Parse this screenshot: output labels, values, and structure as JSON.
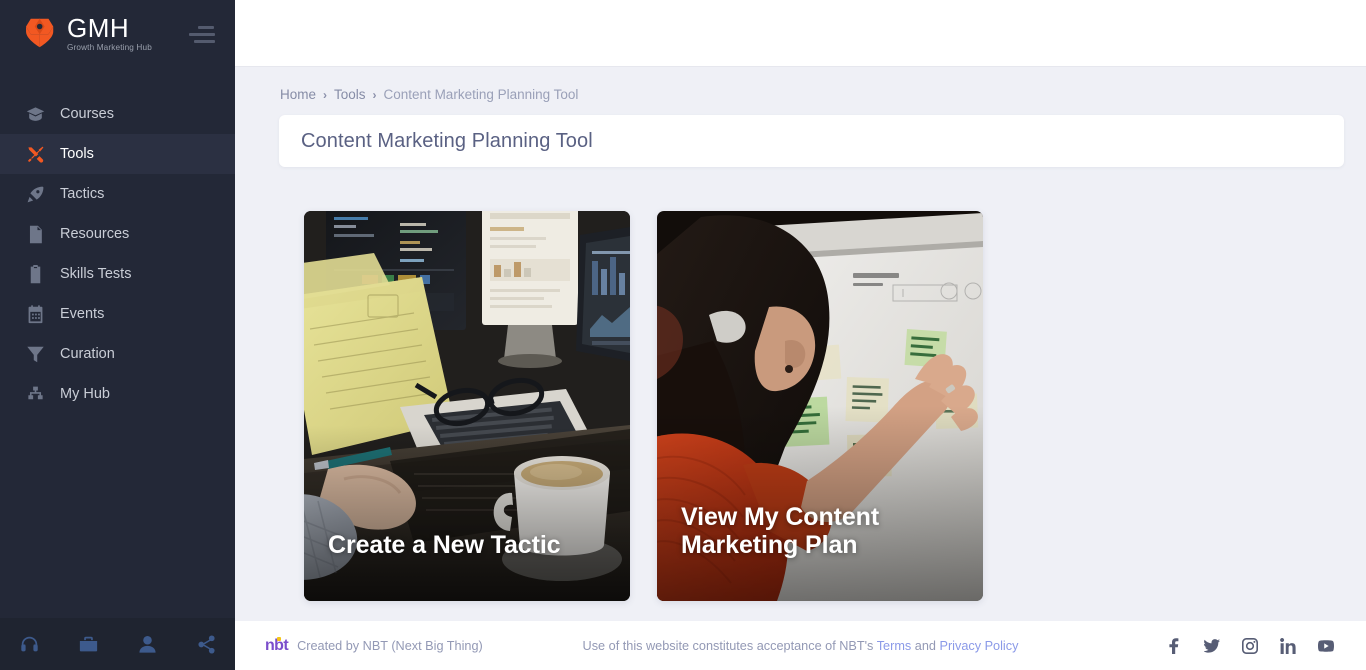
{
  "sidebar": {
    "logo": {
      "title": "GMH",
      "subtitle": "Growth Marketing Hub",
      "mark": "hexagon-logo-icon"
    },
    "menu_icon": "hamburger-menu-icon",
    "items": [
      {
        "label": "Courses",
        "icon": "graduation-cap-icon",
        "active": false
      },
      {
        "label": "Tools",
        "icon": "tools-icon",
        "active": true
      },
      {
        "label": "Tactics",
        "icon": "rocket-icon",
        "active": false
      },
      {
        "label": "Resources",
        "icon": "document-icon",
        "active": false
      },
      {
        "label": "Skills Tests",
        "icon": "clipboard-check-icon",
        "active": false
      },
      {
        "label": "Events",
        "icon": "calendar-icon",
        "active": false
      },
      {
        "label": "Curation",
        "icon": "funnel-icon",
        "active": false
      },
      {
        "label": "My Hub",
        "icon": "sitemap-icon",
        "active": false
      }
    ],
    "bottom_icons": [
      "headphones-icon",
      "briefcase-icon",
      "user-icon",
      "share-icon"
    ],
    "accent_color": "#f25822",
    "background_color": "#232837"
  },
  "breadcrumb": {
    "items": [
      "Home",
      "Tools",
      "Content Marketing Planning Tool"
    ],
    "separator": "›"
  },
  "page": {
    "title": "Content Marketing Planning Tool"
  },
  "cards": [
    {
      "label": "Create a New Tactic",
      "image": "desk-with-laptop-papers-coffee-photo"
    },
    {
      "label": "View My Content Marketing Plan",
      "label_line1": "View My Content",
      "label_line2": "Marketing Plan",
      "image": "woman-at-whiteboard-with-sticky-notes-photo"
    }
  ],
  "footer": {
    "brand_mark": "nbt",
    "credit": "Created by  NBT (Next Big Thing)",
    "legal_prefix": "Use of this website constitutes acceptance of NBT's ",
    "terms_label": "Terms",
    "legal_mid": " and ",
    "privacy_label": "Privacy Policy",
    "social": [
      "facebook-icon",
      "twitter-icon",
      "instagram-icon",
      "linkedin-icon",
      "youtube-icon"
    ]
  }
}
